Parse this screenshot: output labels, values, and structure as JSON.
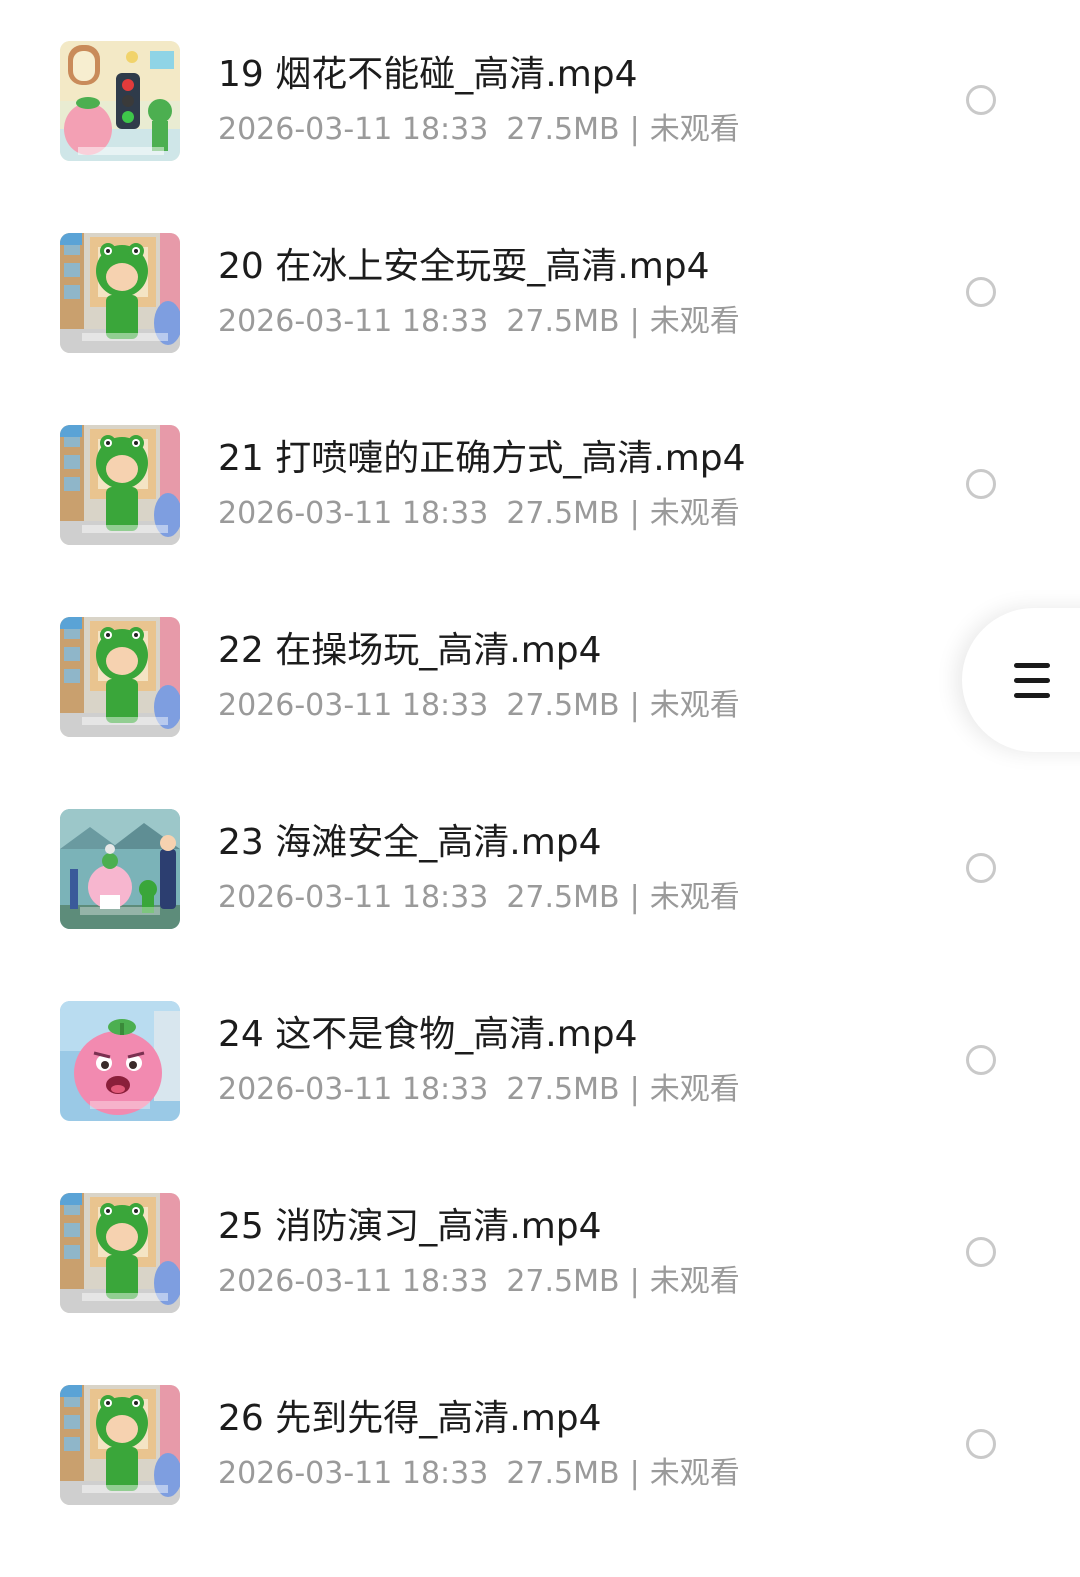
{
  "files": [
    {
      "name": "19 烟花不能碰_高清.mp4",
      "date": "2026-03-11 18:33",
      "size": "27.5MB",
      "status": "未观看",
      "thumbnail": "traffic-light-scene-thumbnail"
    },
    {
      "name": "20 在冰上安全玩耍_高清.mp4",
      "date": "2026-03-11 18:33",
      "size": "27.5MB",
      "status": "未观看",
      "thumbnail": "frog-hood-character-thumbnail"
    },
    {
      "name": "21 打喷嚏的正确方式_高清.mp4",
      "date": "2026-03-11 18:33",
      "size": "27.5MB",
      "status": "未观看",
      "thumbnail": "frog-hood-character-thumbnail"
    },
    {
      "name": "22 在操场玩_高清.mp4",
      "date": "2026-03-11 18:33",
      "size": "27.5MB",
      "status": "未观看",
      "thumbnail": "frog-hood-character-thumbnail"
    },
    {
      "name": "23 海滩安全_高清.mp4",
      "date": "2026-03-11 18:33",
      "size": "27.5MB",
      "status": "未观看",
      "thumbnail": "beach-scene-thumbnail"
    },
    {
      "name": "24 这不是食物_高清.mp4",
      "date": "2026-03-11 18:33",
      "size": "27.5MB",
      "status": "未观看",
      "thumbnail": "pink-peach-character-thumbnail"
    },
    {
      "name": "25 消防演习_高清.mp4",
      "date": "2026-03-11 18:33",
      "size": "27.5MB",
      "status": "未观看",
      "thumbnail": "frog-hood-character-thumbnail"
    },
    {
      "name": "26 先到先得_高清.mp4",
      "date": "2026-03-11 18:33",
      "size": "27.5MB",
      "status": "未观看",
      "thumbnail": "frog-hood-character-thumbnail"
    }
  ],
  "floating_menu": {
    "icon": "hamburger-menu-icon"
  },
  "colors": {
    "title_text": "#1c1c1c",
    "meta_text": "#9a9a9a",
    "radio_border": "#c9c9c9",
    "frog_green": "#3aa63a",
    "peach_pink": "#f28ab0"
  }
}
